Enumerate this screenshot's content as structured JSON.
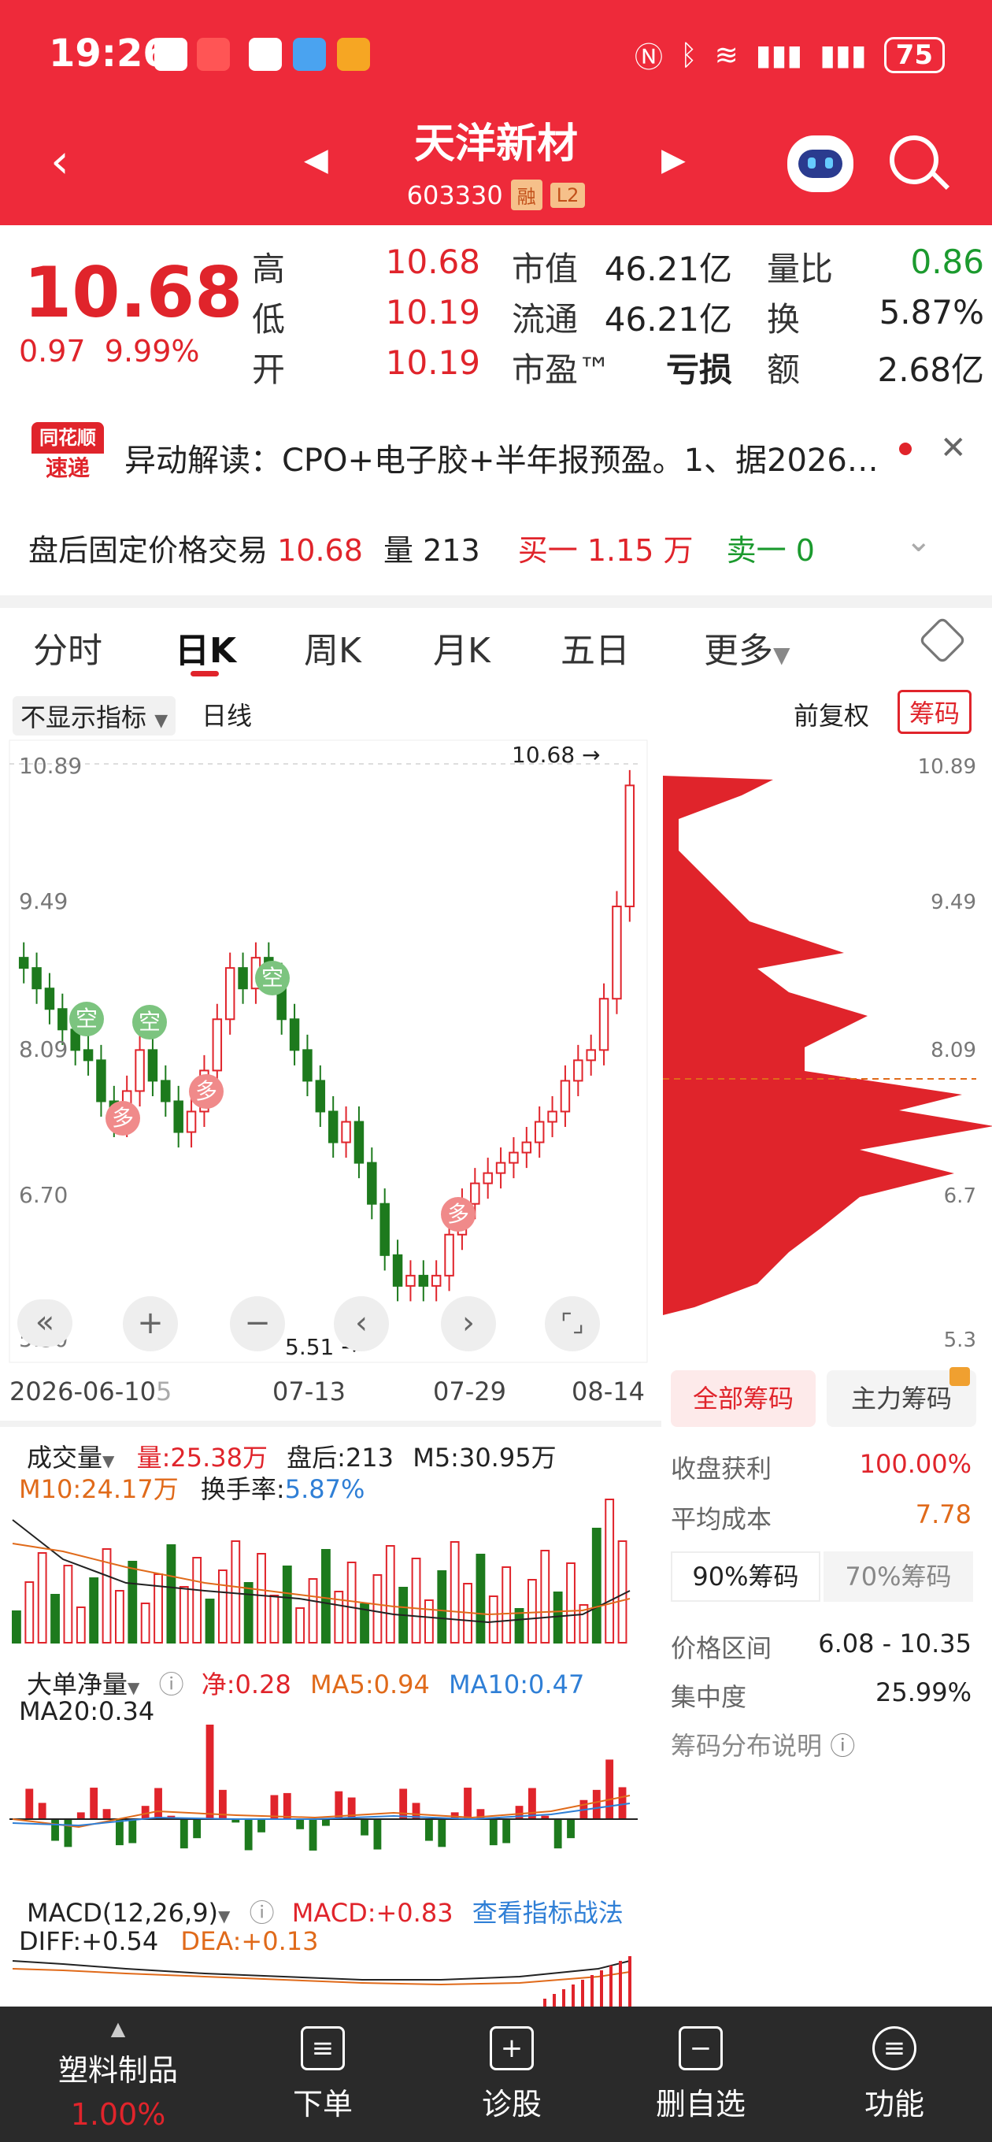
{
  "status": {
    "time": "19:26",
    "battery": "75"
  },
  "header": {
    "name": "天洋新材",
    "code": "603330",
    "tag1": "融",
    "tag2": "L2"
  },
  "quote": {
    "price": "10.68",
    "change": "0.97",
    "change_pct": "9.99%",
    "rows": [
      {
        "l1": "高",
        "v1": "10.68",
        "l2": "市值",
        "v2": "46.21亿",
        "l3": "量比",
        "v3": "0.86"
      },
      {
        "l1": "低",
        "v1": "10.19",
        "l2": "流通",
        "v2": "46.21亿",
        "l3": "换",
        "v3": "5.87%"
      },
      {
        "l1": "开",
        "v1": "10.19",
        "l2": "市盈™",
        "v2": "亏损",
        "l3": "额",
        "v3": "2.68亿"
      }
    ]
  },
  "news": {
    "logo_top": "同花顺",
    "logo_bottom": "速递",
    "text": "异动解读：CPO+电子胶+半年报预盈。1、据2026…"
  },
  "after_hours": {
    "label": "盘后固定价格交易",
    "price": "10.68",
    "vol_label": "量",
    "vol": "213",
    "buy_label": "买一",
    "buy": "1.15 万",
    "sell_label": "卖一",
    "sell": "0"
  },
  "tabs": [
    "分时",
    "日K",
    "周K",
    "月K",
    "五日",
    "更多"
  ],
  "toolbar": {
    "indicator": "不显示指标",
    "period": "日线",
    "adjust": "前复权",
    "chips": "筹码"
  },
  "kline": {
    "y_labels": [
      "10.89",
      "9.49",
      "8.09",
      "6.70",
      "5.30"
    ],
    "right_labels": [
      "10.89",
      "9.49",
      "8.09",
      "6.7",
      "5.3"
    ],
    "high_mark": "10.68",
    "low_mark": "5.51",
    "dates": [
      "2026-06-10",
      "07-13",
      "07-29",
      "08-14"
    ],
    "date_suffix": "5",
    "badge_kong": "空",
    "badge_duo": "多"
  },
  "chips_panel": {
    "tab_all": "全部筹码",
    "tab_main": "主力筹码",
    "profit_label": "收盘获利",
    "profit": "100.00%",
    "avg_label": "平均成本",
    "avg": "7.78",
    "btn90": "90%筹码",
    "btn70": "70%筹码",
    "range_label": "价格区间",
    "range": "6.08 - 10.35",
    "conc_label": "集中度",
    "conc": "25.99%",
    "explain": "筹码分布说明"
  },
  "volume": {
    "title": "成交量",
    "vol": "量:25.38万",
    "after": "盘后:213",
    "m5": "M5:30.95万",
    "m10": "M10:24.17万",
    "turnover_label": "换手率:",
    "turnover": "5.87%"
  },
  "bigorder": {
    "title": "大单净量",
    "net": "净:0.28",
    "ma5": "MA5:0.94",
    "ma10": "MA10:0.47",
    "ma20": "MA20:0.34"
  },
  "macd": {
    "title": "MACD(12,26,9)",
    "macd": "MACD:+0.83",
    "link": "查看指标战法",
    "diff": "DIFF:+0.54",
    "dea": "DEA:+0.13"
  },
  "bottom": {
    "sector": "塑料制品",
    "sector_pct": "1.00%",
    "order": "下单",
    "diagnose": "诊股",
    "remove": "删自选",
    "func": "功能"
  }
}
